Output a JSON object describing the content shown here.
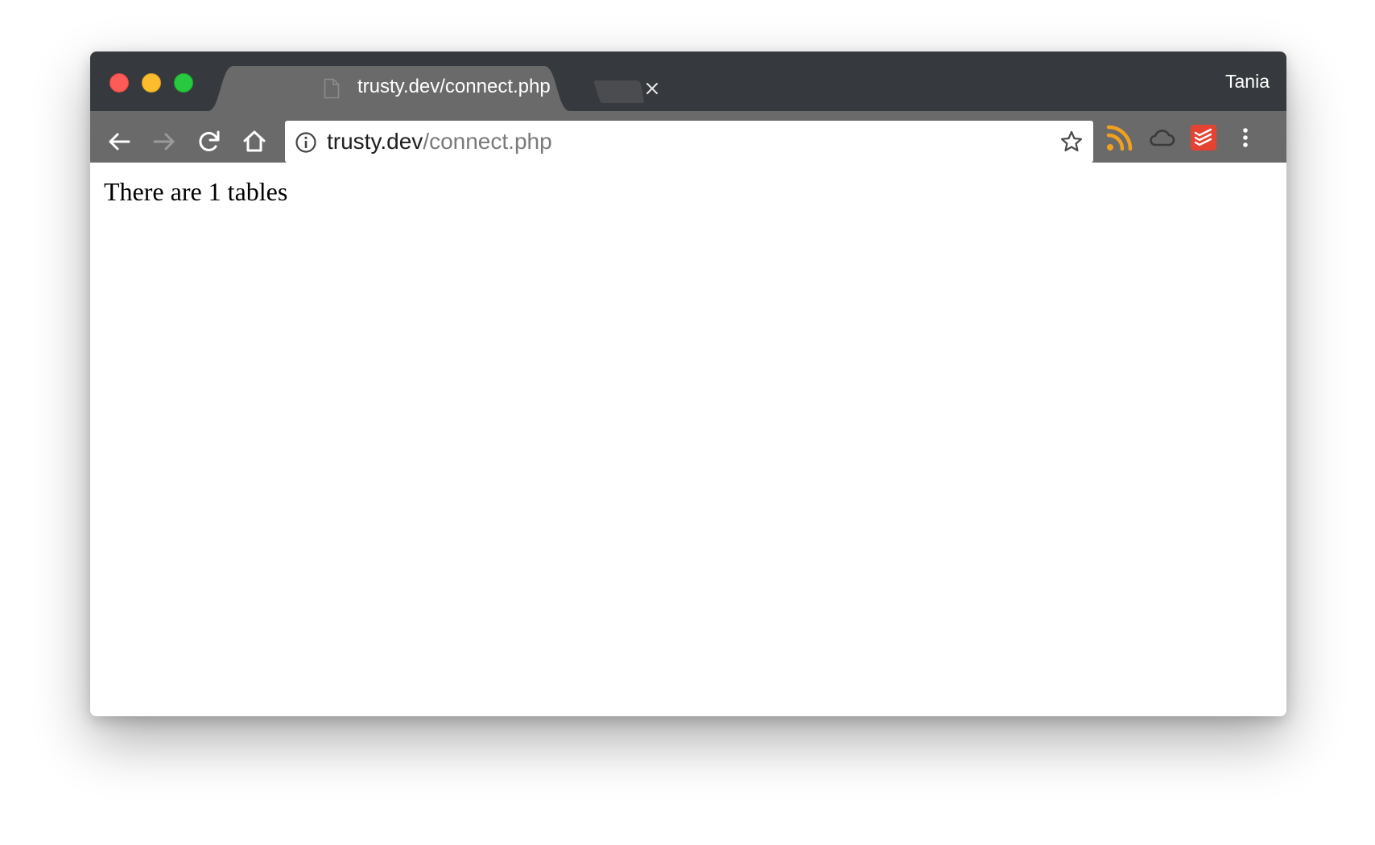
{
  "browser": {
    "tab": {
      "title": "trusty.dev/connect.php"
    },
    "profile_name": "Tania",
    "address_bar": {
      "host": "trusty.dev",
      "path": "/connect.php"
    },
    "extensions": [
      {
        "name": "rss-icon",
        "color": "#f2a020"
      },
      {
        "name": "cloud-icon",
        "color": "#3a3a3a"
      },
      {
        "name": "todoist-icon",
        "color": "#e44332"
      }
    ]
  },
  "page": {
    "body_text": "There are 1 tables"
  }
}
